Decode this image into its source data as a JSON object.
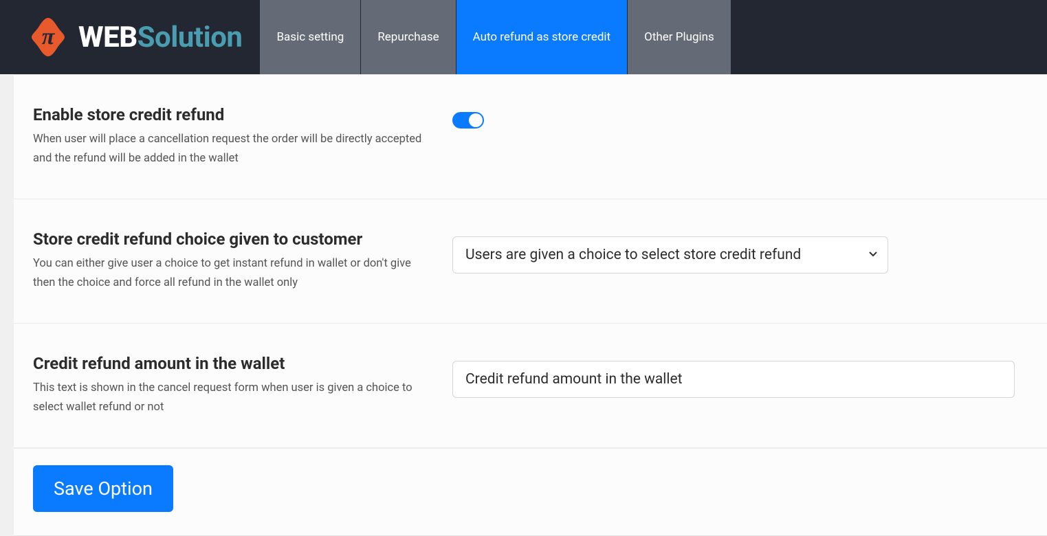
{
  "logo": {
    "web": "WEB",
    "solution": "Solution"
  },
  "tabs": [
    {
      "label": "Basic setting",
      "active": false
    },
    {
      "label": "Repurchase",
      "active": false
    },
    {
      "label": "Auto refund as store credit",
      "active": true
    },
    {
      "label": "Other Plugins",
      "active": false
    }
  ],
  "settings": {
    "enable": {
      "title": "Enable store credit refund",
      "desc": "When user will place a cancellation request the order will be directly accepted and the refund will be added in the wallet",
      "enabled": true
    },
    "choice": {
      "title": "Store credit refund choice given to customer",
      "desc": "You can either give user a choice to get instant refund in wallet or don't give then the choice and force all refund in the wallet only",
      "selected": "Users are given a choice to select store credit refund"
    },
    "credit_text": {
      "title": "Credit refund amount in the wallet",
      "desc": "This text is shown in the cancel request form when user is given a choice to select wallet refund or not",
      "value": "Credit refund amount in the wallet"
    }
  },
  "save_label": "Save Option"
}
